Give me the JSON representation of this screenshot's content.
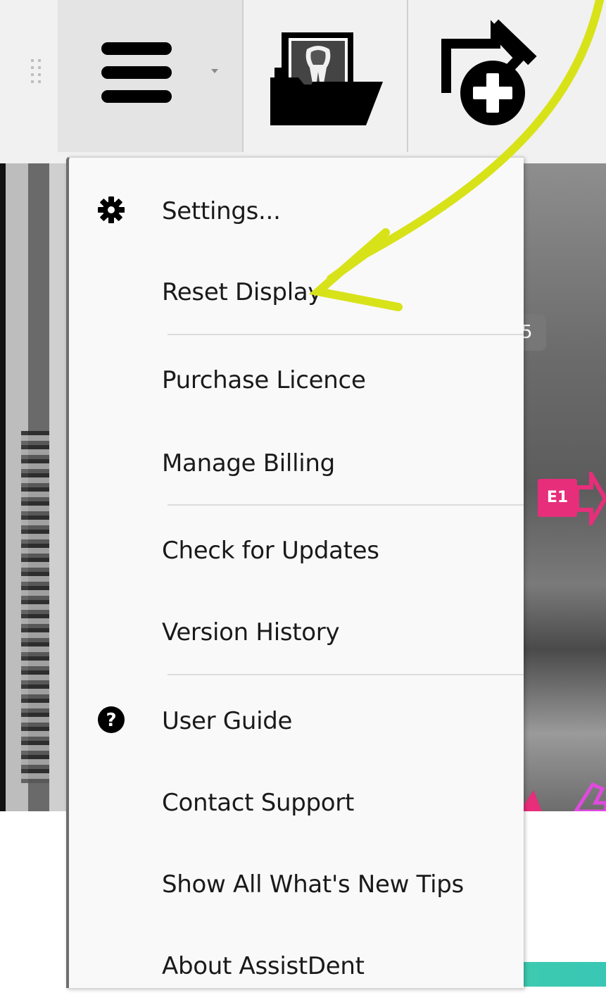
{
  "toolbar": {
    "menu_button_icon": "hamburger-menu-icon",
    "tools": [
      "open-xray-folder-icon",
      "new-export-icon"
    ]
  },
  "viewer": {
    "partial_label": "5",
    "marker_label": "E1"
  },
  "menu": {
    "items": [
      {
        "label": "Settings...",
        "icon": "gear-icon"
      },
      {
        "label": "Reset Display",
        "icon": ""
      },
      {
        "label": "Purchase Licence",
        "icon": ""
      },
      {
        "label": "Manage Billing",
        "icon": ""
      },
      {
        "label": "Check for Updates",
        "icon": ""
      },
      {
        "label": "Version History",
        "icon": ""
      },
      {
        "label": "User Guide",
        "icon": "help-circle-icon"
      },
      {
        "label": "Contact Support",
        "icon": ""
      },
      {
        "label": "Show All What's New Tips",
        "icon": ""
      },
      {
        "label": "About AssistDent",
        "icon": ""
      }
    ]
  },
  "colors": {
    "annotation_arrow": "#d8e219",
    "marker": "#e62e7a",
    "accent_bar": "#45cfa6"
  }
}
